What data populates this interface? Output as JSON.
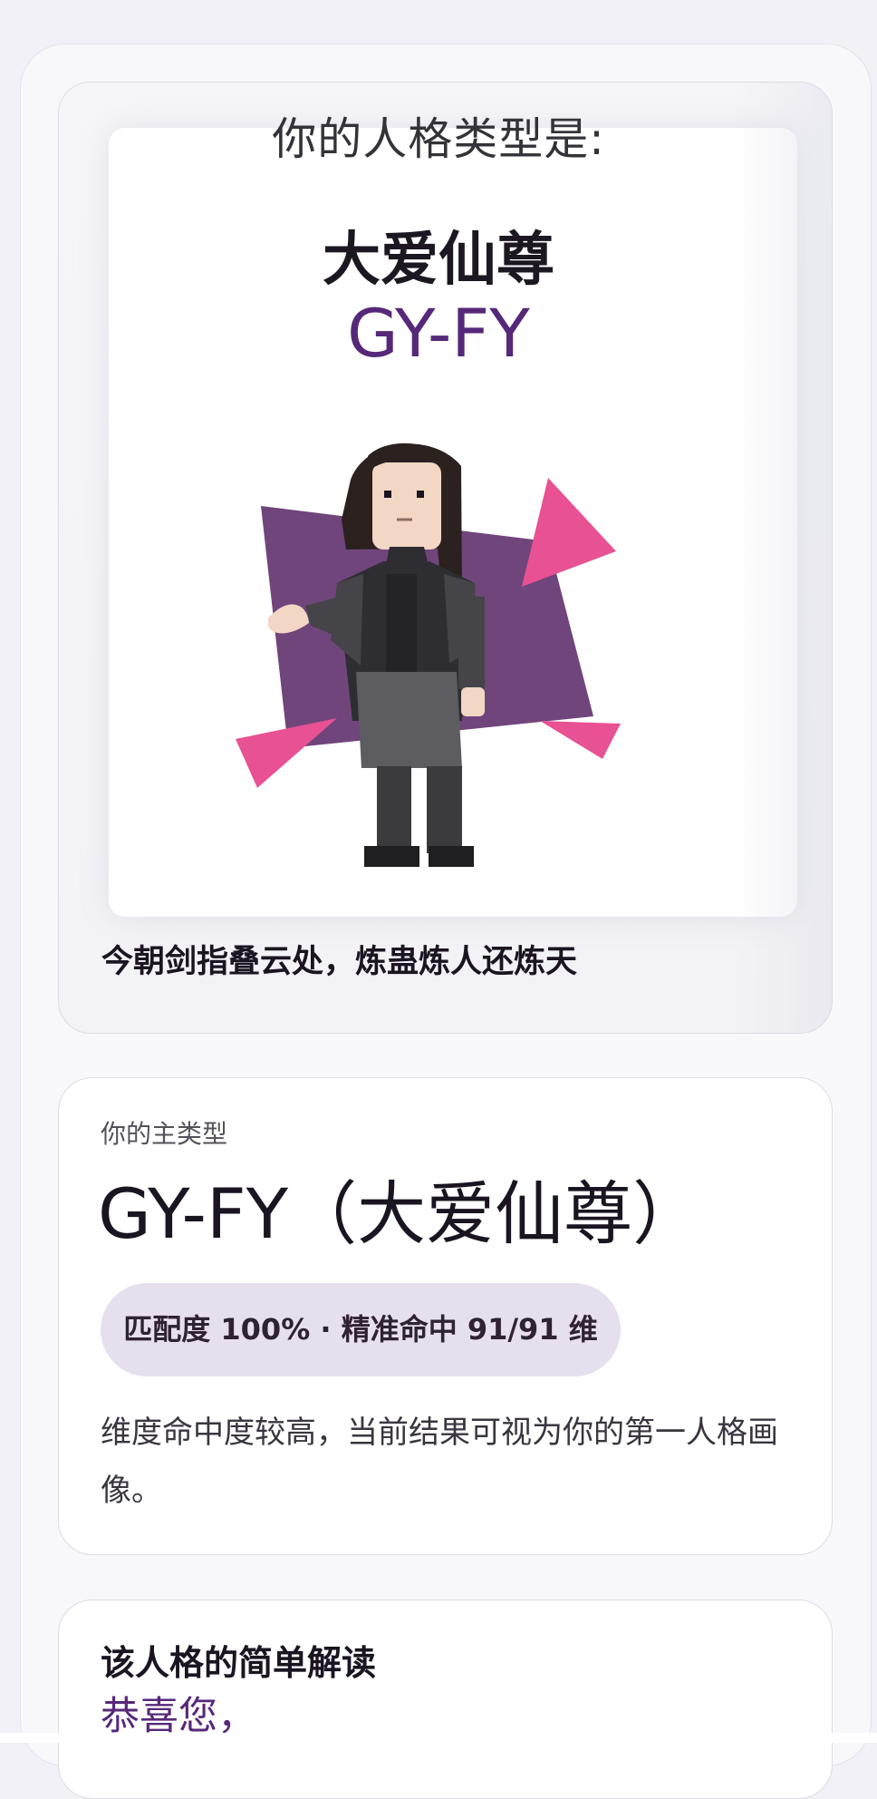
{
  "header": {
    "prompt": "你的人格类型是:",
    "type_name": "大爱仙尊",
    "type_code": "GY-FY"
  },
  "illustration": {
    "icon": "character-portrait-icon",
    "colors": {
      "panel": "#70457b",
      "accent": "#e85193",
      "hair": "#2b211f",
      "coat": "#3b3b3e",
      "skin": "#f2d7c5"
    }
  },
  "motto": "今朝剑指叠云处，炼蛊炼人还炼天",
  "summary": {
    "label": "你的主类型",
    "title": "GY-FY（大爱仙尊）",
    "match": "匹配度 100% · 精准命中 91/91 维",
    "description": "维度命中度较高，当前结果可视为你的第一人格画像。"
  },
  "interpretation": {
    "heading": "该人格的简单解读",
    "greeting": "恭喜您，"
  }
}
